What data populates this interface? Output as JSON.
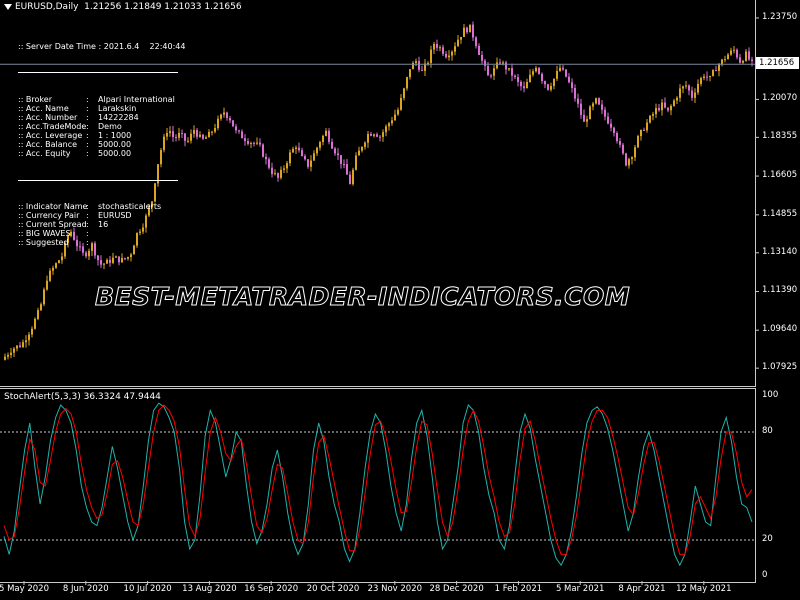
{
  "header": {
    "symbol": "EURUSD,Daily",
    "ohlc": "1.21256 1.21849 1.21033 1.21656"
  },
  "info_panel": {
    "server_time": ":: Server Date Time : 2021.6.4    22:40:44",
    "account_rows": [
      {
        "key": ":: Broker",
        "value": "Alpari International"
      },
      {
        "key": ":: Acc. Name",
        "value": "Larakskin"
      },
      {
        "key": ":: Acc. Number",
        "value": "14222284"
      },
      {
        "key": ":: Acc.TradeMode",
        "value": "Demo"
      },
      {
        "key": ":: Acc. Leverage",
        "value": "1 : 1000"
      },
      {
        "key": ":: Acc. Balance",
        "value": "5000.00"
      },
      {
        "key": ":: Acc. Equity",
        "value": "5000.00"
      }
    ],
    "indicator_rows": [
      {
        "key": ":: Indicator Name",
        "value": "stochasticalerts"
      },
      {
        "key": ":: Currency Pair",
        "value": "EURUSD"
      },
      {
        "key": ":: Current Spread",
        "value": "16"
      },
      {
        "key": ":: BIG WAVES",
        "value": ""
      },
      {
        "key": ":: Suggested",
        "value": ""
      }
    ]
  },
  "watermark": "BEST-METATRADER-INDICATORS.COM",
  "current_price_tag": "1.21656",
  "oscillator_label": "StochAlert(5,3,3) 36.3324 47.9444",
  "colors": {
    "background": "#000000",
    "bull_candle": "#DAA520",
    "bear_candle": "#DA70D6",
    "stoch_main": "#20B2AA",
    "stoch_signal": "#FF0000",
    "grid_level": "#C8C8C8",
    "axis_text": "#FFFFFF"
  },
  "chart_data": [
    {
      "type": "candlestick",
      "title": "EURUSD,Daily",
      "y_ticks": [
        "1.23750",
        "1.21656",
        "1.20070",
        "1.18355",
        "1.16605",
        "1.14855",
        "1.13140",
        "1.11390",
        "1.09640",
        "1.07925"
      ],
      "ylim": [
        1.073,
        1.242
      ],
      "current_price": 1.21656,
      "x_ticks": [
        "5 May 2020",
        "8 Jun 2020",
        "10 Jul 2020",
        "13 Aug 2020",
        "16 Sep 2020",
        "20 Oct 2020",
        "23 Nov 2020",
        "28 Dec 2020",
        "1 Feb 2021",
        "5 Mar 2021",
        "8 Apr 2021",
        "12 May 2021"
      ],
      "close_path": [
        [
          0,
          1.083
        ],
        [
          10,
          1.088
        ],
        [
          20,
          1.09
        ],
        [
          30,
          1.098
        ],
        [
          38,
          1.106
        ],
        [
          45,
          1.12
        ],
        [
          52,
          1.125
        ],
        [
          60,
          1.13
        ],
        [
          68,
          1.142
        ],
        [
          75,
          1.135
        ],
        [
          82,
          1.13
        ],
        [
          90,
          1.135
        ],
        [
          98,
          1.126
        ],
        [
          105,
          1.127
        ],
        [
          112,
          1.129
        ],
        [
          120,
          1.128
        ],
        [
          128,
          1.13
        ],
        [
          135,
          1.14
        ],
        [
          142,
          1.145
        ],
        [
          150,
          1.155
        ],
        [
          155,
          1.17
        ],
        [
          160,
          1.18
        ],
        [
          166,
          1.188
        ],
        [
          172,
          1.183
        ],
        [
          178,
          1.185
        ],
        [
          185,
          1.181
        ],
        [
          192,
          1.187
        ],
        [
          200,
          1.182
        ],
        [
          208,
          1.185
        ],
        [
          215,
          1.19
        ],
        [
          222,
          1.195
        ],
        [
          228,
          1.192
        ],
        [
          234,
          1.186
        ],
        [
          240,
          1.184
        ],
        [
          246,
          1.182
        ],
        [
          252,
          1.181
        ],
        [
          258,
          1.179
        ],
        [
          264,
          1.173
        ],
        [
          270,
          1.168
        ],
        [
          276,
          1.165
        ],
        [
          282,
          1.17
        ],
        [
          288,
          1.176
        ],
        [
          294,
          1.18
        ],
        [
          300,
          1.174
        ],
        [
          306,
          1.171
        ],
        [
          312,
          1.176
        ],
        [
          318,
          1.182
        ],
        [
          324,
          1.186
        ],
        [
          330,
          1.18
        ],
        [
          336,
          1.175
        ],
        [
          342,
          1.17
        ],
        [
          348,
          1.163
        ],
        [
          354,
          1.174
        ],
        [
          360,
          1.18
        ],
        [
          366,
          1.185
        ],
        [
          372,
          1.186
        ],
        [
          378,
          1.184
        ],
        [
          384,
          1.188
        ],
        [
          390,
          1.192
        ],
        [
          396,
          1.196
        ],
        [
          402,
          1.205
        ],
        [
          408,
          1.215
        ],
        [
          414,
          1.218
        ],
        [
          420,
          1.213
        ],
        [
          426,
          1.218
        ],
        [
          432,
          1.226
        ],
        [
          438,
          1.224
        ],
        [
          444,
          1.221
        ],
        [
          450,
          1.223
        ],
        [
          456,
          1.228
        ],
        [
          462,
          1.232
        ],
        [
          468,
          1.233
        ],
        [
          474,
          1.226
        ],
        [
          480,
          1.218
        ],
        [
          486,
          1.211
        ],
        [
          492,
          1.214
        ],
        [
          498,
          1.218
        ],
        [
          504,
          1.215
        ],
        [
          510,
          1.212
        ],
        [
          516,
          1.208
        ],
        [
          522,
          1.205
        ],
        [
          528,
          1.211
        ],
        [
          534,
          1.216
        ],
        [
          540,
          1.21
        ],
        [
          546,
          1.206
        ],
        [
          552,
          1.21
        ],
        [
          558,
          1.215
        ],
        [
          564,
          1.211
        ],
        [
          570,
          1.205
        ],
        [
          576,
          1.198
        ],
        [
          582,
          1.19
        ],
        [
          588,
          1.196
        ],
        [
          594,
          1.2
        ],
        [
          600,
          1.195
        ],
        [
          606,
          1.191
        ],
        [
          612,
          1.187
        ],
        [
          618,
          1.179
        ],
        [
          624,
          1.172
        ],
        [
          630,
          1.176
        ],
        [
          636,
          1.183
        ],
        [
          642,
          1.188
        ],
        [
          648,
          1.192
        ],
        [
          654,
          1.196
        ],
        [
          660,
          1.198
        ],
        [
          666,
          1.195
        ],
        [
          672,
          1.2
        ],
        [
          678,
          1.205
        ],
        [
          684,
          1.207
        ],
        [
          690,
          1.202
        ],
        [
          696,
          1.208
        ],
        [
          702,
          1.212
        ],
        [
          708,
          1.21
        ],
        [
          714,
          1.215
        ],
        [
          720,
          1.218
        ],
        [
          726,
          1.221
        ],
        [
          732,
          1.223
        ],
        [
          738,
          1.218
        ],
        [
          744,
          1.221
        ],
        [
          750,
          1.2166
        ]
      ]
    },
    {
      "type": "line",
      "title": "StochAlert(5,3,3) 36.3324 47.9444",
      "ylim": [
        0,
        100
      ],
      "y_ticks": [
        100,
        80,
        20,
        0
      ],
      "levels": [
        80,
        20
      ],
      "main_last": 36.3324,
      "signal_last": 47.9444,
      "series": [
        {
          "name": "Main",
          "values": [
            22,
            12,
            25,
            48,
            70,
            85,
            60,
            40,
            55,
            75,
            88,
            95,
            92,
            85,
            70,
            50,
            38,
            30,
            28,
            38,
            55,
            72,
            60,
            45,
            30,
            20,
            28,
            50,
            75,
            92,
            96,
            94,
            88,
            80,
            60,
            30,
            15,
            20,
            45,
            78,
            92,
            85,
            70,
            55,
            65,
            80,
            75,
            50,
            30,
            18,
            25,
            40,
            60,
            70,
            55,
            35,
            20,
            12,
            18,
            40,
            70,
            85,
            75,
            55,
            40,
            30,
            15,
            8,
            15,
            35,
            60,
            80,
            90,
            85,
            70,
            50,
            35,
            25,
            40,
            65,
            85,
            92,
            78,
            55,
            30,
            15,
            20,
            40,
            60,
            85,
            95,
            92,
            80,
            60,
            45,
            35,
            20,
            15,
            28,
            55,
            80,
            90,
            82,
            65,
            50,
            35,
            20,
            10,
            6,
            12,
            25,
            45,
            68,
            85,
            92,
            94,
            90,
            82,
            70,
            55,
            40,
            25,
            35,
            55,
            72,
            80,
            70,
            55,
            40,
            25,
            12,
            6,
            12,
            30,
            50,
            40,
            30,
            28,
            55,
            80,
            88,
            75,
            55,
            40,
            38,
            30
          ]
        },
        {
          "name": "Signal",
          "values": [
            28,
            20,
            22,
            38,
            58,
            76,
            70,
            52,
            50,
            64,
            80,
            90,
            93,
            90,
            80,
            62,
            48,
            38,
            32,
            34,
            46,
            62,
            64,
            55,
            42,
            30,
            28,
            40,
            60,
            80,
            92,
            95,
            92,
            86,
            72,
            48,
            28,
            22,
            32,
            58,
            80,
            88,
            80,
            68,
            64,
            72,
            76,
            62,
            44,
            28,
            24,
            32,
            48,
            62,
            60,
            46,
            30,
            20,
            18,
            30,
            55,
            74,
            78,
            66,
            52,
            38,
            25,
            14,
            14,
            26,
            46,
            68,
            84,
            86,
            78,
            64,
            48,
            35,
            36,
            52,
            72,
            86,
            84,
            68,
            48,
            30,
            22,
            30,
            48,
            70,
            86,
            92,
            86,
            72,
            56,
            44,
            30,
            22,
            24,
            40,
            64,
            82,
            86,
            75,
            60,
            46,
            32,
            20,
            12,
            12,
            20,
            34,
            54,
            74,
            86,
            92,
            92,
            88,
            78,
            66,
            52,
            38,
            34,
            46,
            62,
            74,
            74,
            64,
            50,
            36,
            22,
            12,
            12,
            22,
            40,
            44,
            38,
            32,
            44,
            65,
            80,
            80,
            68,
            52,
            44,
            48
          ]
        }
      ]
    }
  ]
}
